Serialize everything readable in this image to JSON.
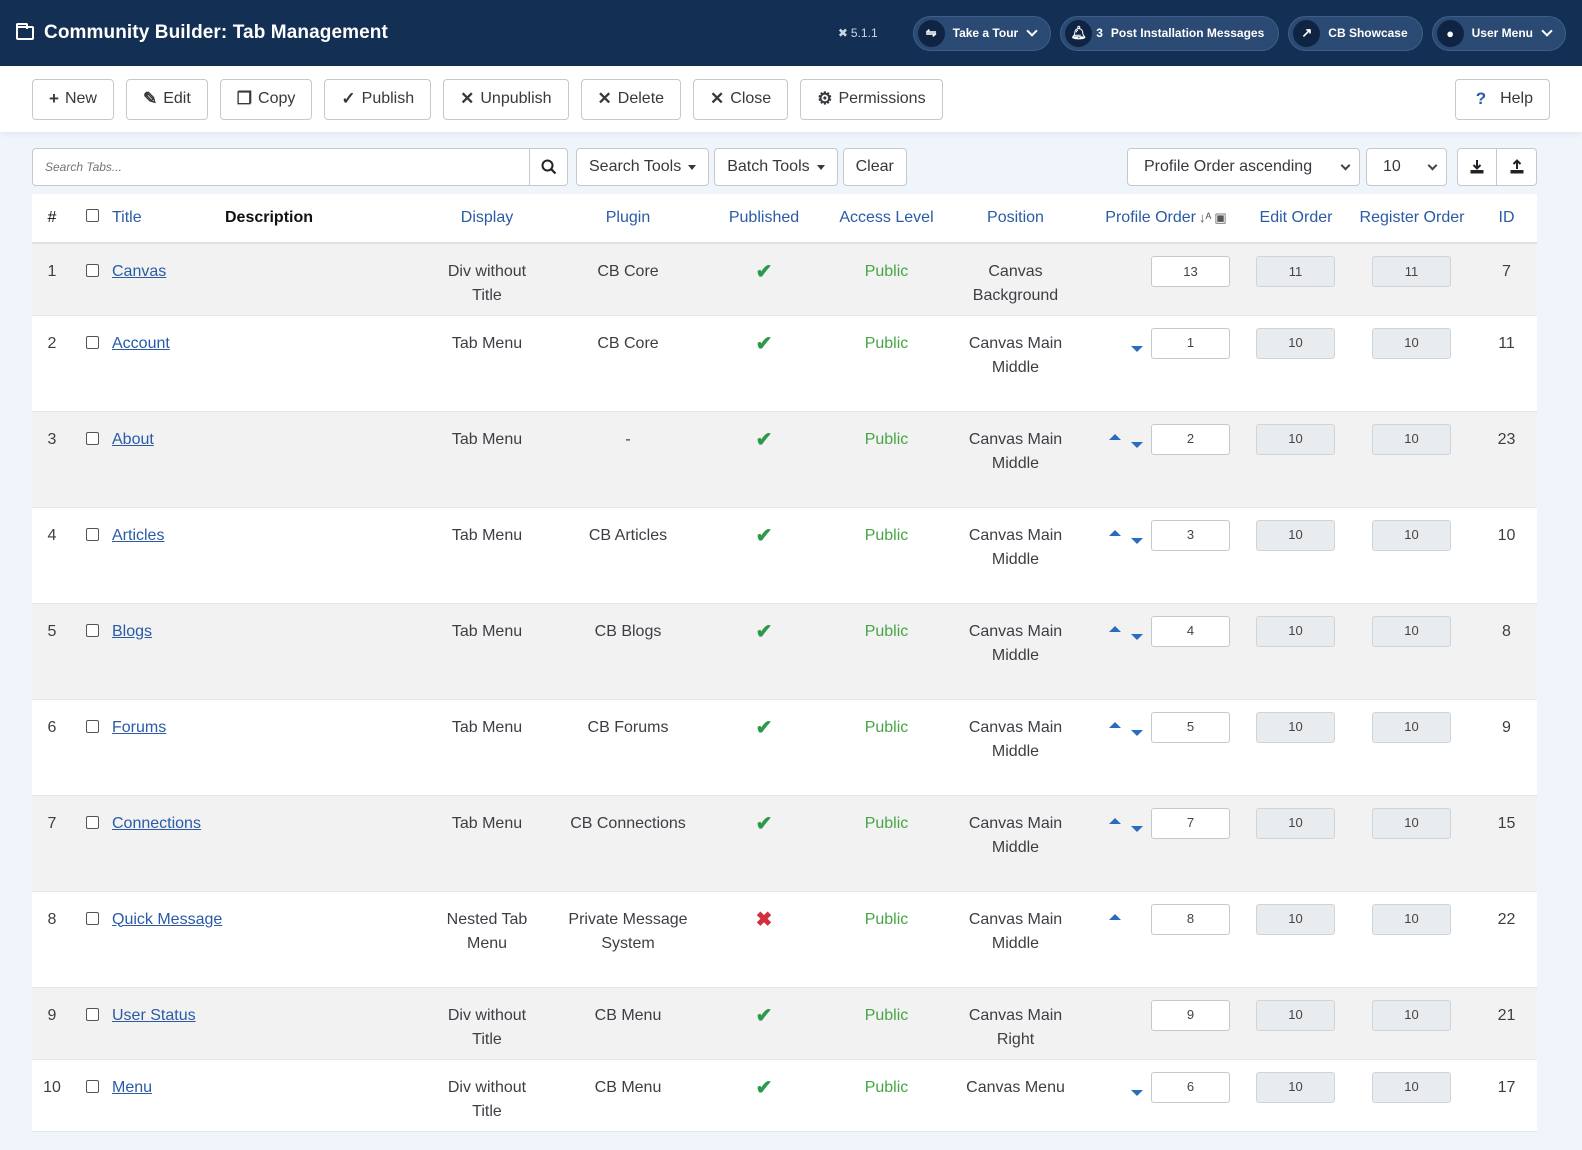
{
  "header": {
    "title": "Community Builder: Tab Management",
    "version": "5.1.1",
    "tour_label": "Take a Tour",
    "messages_count": "3",
    "messages_label": "Post Installation Messages",
    "showcase_label": "CB Showcase",
    "user_menu_label": "User Menu"
  },
  "toolbar": {
    "new": "New",
    "edit": "Edit",
    "copy": "Copy",
    "publish": "Publish",
    "unpublish": "Unpublish",
    "delete": "Delete",
    "close": "Close",
    "permissions": "Permissions",
    "help": "Help"
  },
  "filters": {
    "search_placeholder": "Search Tabs...",
    "search_tools": "Search Tools",
    "batch_tools": "Batch Tools",
    "clear": "Clear",
    "ordering": "Profile Order ascending",
    "limit": "10"
  },
  "columns": {
    "num": "#",
    "title": "Title",
    "description": "Description",
    "display": "Display",
    "plugin": "Plugin",
    "published": "Published",
    "access": "Access Level",
    "position": "Position",
    "profile_order": "Profile Order",
    "edit_order": "Edit Order",
    "register_order": "Register Order",
    "id": "ID"
  },
  "rows": [
    {
      "num": "1",
      "title": "Canvas",
      "display": "Div without Title",
      "plugin": "CB Core",
      "published": true,
      "access": "Public",
      "position": "Canvas Background",
      "up": false,
      "down": false,
      "profile_order": "13",
      "edit_order": "11",
      "register_order": "11",
      "id": "7"
    },
    {
      "num": "2",
      "title": "Account",
      "display": "Tab Menu",
      "plugin": "CB Core",
      "published": true,
      "access": "Public",
      "position": "Canvas Main Middle",
      "up": false,
      "down": true,
      "profile_order": "1",
      "edit_order": "10",
      "register_order": "10",
      "id": "11"
    },
    {
      "num": "3",
      "title": "About",
      "display": "Tab Menu",
      "plugin": "-",
      "published": true,
      "access": "Public",
      "position": "Canvas Main Middle",
      "up": true,
      "down": true,
      "profile_order": "2",
      "edit_order": "10",
      "register_order": "10",
      "id": "23"
    },
    {
      "num": "4",
      "title": "Articles",
      "display": "Tab Menu",
      "plugin": "CB Articles",
      "published": true,
      "access": "Public",
      "position": "Canvas Main Middle",
      "up": true,
      "down": true,
      "profile_order": "3",
      "edit_order": "10",
      "register_order": "10",
      "id": "10"
    },
    {
      "num": "5",
      "title": "Blogs",
      "display": "Tab Menu",
      "plugin": "CB Blogs",
      "published": true,
      "access": "Public",
      "position": "Canvas Main Middle",
      "up": true,
      "down": true,
      "profile_order": "4",
      "edit_order": "10",
      "register_order": "10",
      "id": "8"
    },
    {
      "num": "6",
      "title": "Forums",
      "display": "Tab Menu",
      "plugin": "CB Forums",
      "published": true,
      "access": "Public",
      "position": "Canvas Main Middle",
      "up": true,
      "down": true,
      "profile_order": "5",
      "edit_order": "10",
      "register_order": "10",
      "id": "9"
    },
    {
      "num": "7",
      "title": "Connections",
      "display": "Tab Menu",
      "plugin": "CB Connections",
      "published": true,
      "access": "Public",
      "position": "Canvas Main Middle",
      "up": true,
      "down": true,
      "profile_order": "7",
      "edit_order": "10",
      "register_order": "10",
      "id": "15"
    },
    {
      "num": "8",
      "title": "Quick Message",
      "display": "Nested Tab Menu",
      "plugin": "Private Message System",
      "published": false,
      "access": "Public",
      "position": "Canvas Main Middle",
      "up": true,
      "down": false,
      "profile_order": "8",
      "edit_order": "10",
      "register_order": "10",
      "id": "22"
    },
    {
      "num": "9",
      "title": "User Status",
      "display": "Div without Title",
      "plugin": "CB Menu",
      "published": true,
      "access": "Public",
      "position": "Canvas Main Right",
      "up": false,
      "down": false,
      "profile_order": "9",
      "edit_order": "10",
      "register_order": "10",
      "id": "21"
    },
    {
      "num": "10",
      "title": "Menu",
      "display": "Div without Title",
      "plugin": "CB Menu",
      "published": true,
      "access": "Public",
      "position": "Canvas Menu",
      "up": false,
      "down": true,
      "profile_order": "6",
      "edit_order": "10",
      "register_order": "10",
      "id": "17"
    }
  ],
  "colors": {
    "header_bg": "#132f53",
    "link": "#2a5ba5",
    "published_ok": "#2c9a4a",
    "unpublished": "#d32f3c",
    "access_public": "#46a546"
  }
}
